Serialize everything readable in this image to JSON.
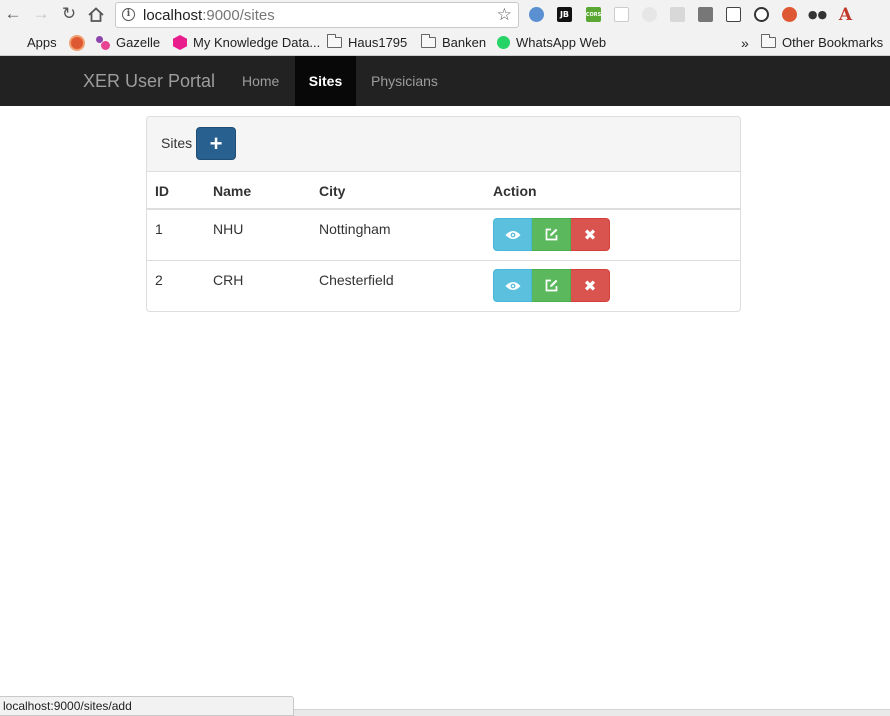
{
  "browser": {
    "url_host": "localhost",
    "url_path": ":9000/sites",
    "bookmarks": [
      "Apps",
      "Gazelle",
      "My Knowledge Data...",
      "Haus1795",
      "Banken",
      "WhatsApp Web"
    ],
    "more_chevron": "»",
    "other_bookmarks": "Other Bookmarks",
    "extensions": [
      "globe-icon",
      "jb-icon",
      "cors-icon",
      "blank-icon",
      "leaf-icon",
      "angular-icon",
      "square-icon",
      "bus-icon",
      "reload-icon",
      "duckduckgo-icon",
      "glasses-icon",
      "font-icon"
    ],
    "ext_labels": {
      "jb": "JB",
      "cors": "CORS",
      "font": "A"
    }
  },
  "navbar": {
    "brand": "XER User Portal",
    "links": [
      "Home",
      "Sites",
      "Physicians"
    ],
    "active": "Sites"
  },
  "panel": {
    "title": "Sites",
    "add_label": "+",
    "headers": [
      "ID",
      "Name",
      "City",
      "Action"
    ],
    "rows": [
      {
        "id": "1",
        "name": "NHU",
        "city": "Nottingham"
      },
      {
        "id": "2",
        "name": "CRH",
        "city": "Chesterfield"
      }
    ],
    "delete_glyph": "✖"
  },
  "status_url": "localhost:9000/sites/add",
  "colors": {
    "navbar": "#222222",
    "primary": "#286090",
    "info": "#5bc0de",
    "success": "#5cb85c",
    "danger": "#d9534f"
  }
}
